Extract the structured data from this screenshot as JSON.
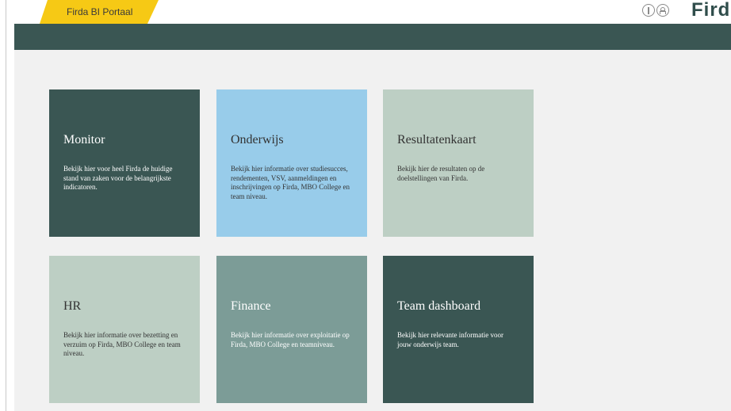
{
  "header": {
    "portal_tab": "Firda BI Portaal",
    "logo_text": "Firda",
    "icons": [
      "info-icon",
      "user-icon"
    ]
  },
  "colors": {
    "brand_dark": "#3a5653",
    "portal_tab": "#f6c915",
    "tile_blue": "#98ccea",
    "tile_sage": "#bdcfc4",
    "tile_teal": "#7c9c97",
    "background": "#f1f1f1"
  },
  "tiles": [
    {
      "title": "Monitor",
      "description": "Bekijk hier voor heel Firda de huidige stand van zaken voor de belangrijkste indicatoren."
    },
    {
      "title": "Onderwijs",
      "description": "Bekijk hier informatie over studiesucces, rendementen, VSV, aanmeldingen en inschrijvingen op Firda, MBO College en team niveau."
    },
    {
      "title": "Resultatenkaart",
      "description": "Bekijk hier de resultaten op de doelstellingen van Firda."
    },
    {
      "title": "HR",
      "description": "Bekijk hier informatie over bezetting en verzuim op Firda, MBO College en team niveau."
    },
    {
      "title": "Finance",
      "description": "Bekijk hier informatie over exploitatie op Firda, MBO College en teamniveau."
    },
    {
      "title": "Team dashboard",
      "description": "Bekijk hier relevante informatie voor jouw onderwijs team."
    }
  ]
}
